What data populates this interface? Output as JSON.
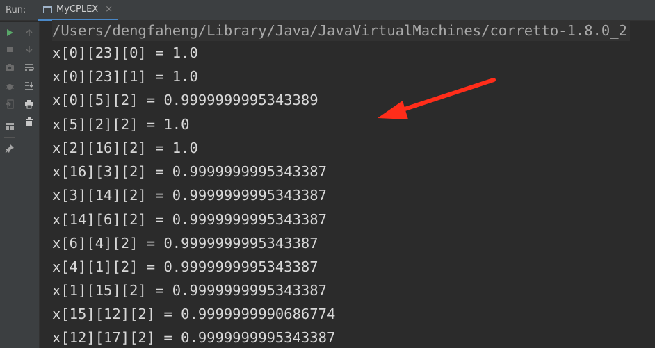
{
  "toolbar": {
    "run_label": "Run:"
  },
  "tab": {
    "title": "MyCPLEX",
    "close": "×"
  },
  "console": {
    "command": "/Users/dengfaheng/Library/Java/JavaVirtualMachines/corretto-1.8.0_2",
    "lines": [
      "x[0][23][0] = 1.0",
      "x[0][23][1] = 1.0",
      "x[0][5][2] = 0.9999999995343389",
      "x[5][2][2] = 1.0",
      "x[2][16][2] = 1.0",
      "x[16][3][2] = 0.9999999995343387",
      "x[3][14][2] = 0.9999999995343387",
      "x[14][6][2] = 0.9999999995343387",
      "x[6][4][2] = 0.9999999995343387",
      "x[4][1][2] = 0.9999999995343387",
      "x[1][15][2] = 0.9999999995343387",
      "x[15][12][2] = 0.9999999990686774",
      "x[12][17][2] = 0.9999999995343387"
    ]
  },
  "colors": {
    "accent": "#4a88c7",
    "run_green": "#59a869",
    "annotation_red": "#ff2d1a"
  },
  "icons": [
    "run-icon",
    "stop-icon",
    "camera-icon",
    "debug-icon",
    "exit-icon",
    "layout-icon",
    "pin-icon",
    "arrow-up-icon",
    "arrow-down-icon",
    "soft-wrap-icon",
    "scroll-to-end-icon",
    "print-icon",
    "trash-icon"
  ]
}
